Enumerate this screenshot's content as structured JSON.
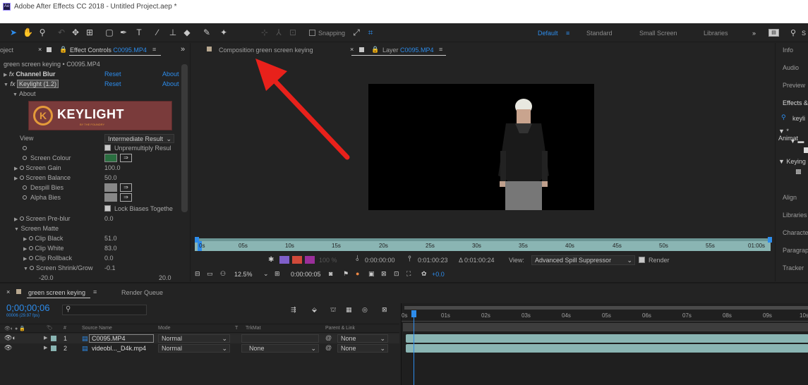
{
  "app": {
    "title": "Adobe After Effects CC 2018 - Untitled Project.aep *",
    "icon_label": "Ae"
  },
  "toolbar": {
    "snapping_label": "Snapping",
    "workspaces": [
      "Default",
      "Standard",
      "Small Screen",
      "Libraries"
    ],
    "active_workspace": "Default",
    "search_partial": "S"
  },
  "effect_controls": {
    "project_tab": "oject",
    "tab_label": "Effect Controls",
    "tab_file": "C0095.MP4",
    "breadcrumb": "green screen keying • C0095.MP4",
    "channel_blur": {
      "name": "Channel Blur",
      "reset": "Reset",
      "about": "About"
    },
    "keylight": {
      "name": "Keylight (1.2)",
      "reset": "Reset",
      "about": "About"
    },
    "about_label": "About",
    "logo_text": "KEYLIGHT",
    "logo_sub": "BY THE FOUNDRY",
    "view_label": "View",
    "view_value": "Intermediate Result",
    "unpremultiply": "Unpremultiply Resul",
    "screen_colour": "Screen Colour",
    "screen_colour_hex": "#2a6e40",
    "screen_gain": "Screen Gain",
    "screen_gain_val": "100.0",
    "screen_balance": "Screen Balance",
    "screen_balance_val": "50.0",
    "despill_bias": "Despill Bies",
    "alpha_bias": "Alpha Bies",
    "lock_biases": "Lock Biases Togethe",
    "screen_preblur": "Screen Pre-blur",
    "screen_preblur_val": "0.0",
    "screen_matte": "Screen Matte",
    "clip_black": "Clip Black",
    "clip_black_val": "51.0",
    "clip_white": "Clip White",
    "clip_white_val": "83.0",
    "clip_rollback": "Clip Rollback",
    "clip_rollback_val": "0.0",
    "shrink_grow": "Screen Shrink/Grow",
    "shrink_grow_val": "-0.1",
    "range_min": "-20.0",
    "range_max": "20.0"
  },
  "composition": {
    "tab_label": "Composition",
    "tab_name": "green screen keying",
    "layer_label": "Layer",
    "layer_name": "C0095.MP4",
    "ruler": [
      "0s",
      "05s",
      "10s",
      "15s",
      "20s",
      "25s",
      "30s",
      "35s",
      "40s",
      "45s",
      "50s",
      "55s",
      "01:00s"
    ],
    "opacity": "100 %",
    "time_in": "0:00:00:00",
    "time_out": "0:01:00:23",
    "duration": "Δ 0:01:00:24",
    "view_label": "View:",
    "view_value": "Advanced Spill Suppressor",
    "render_label": "Render",
    "zoom": "12.5%",
    "current_time": "0:00:00:05",
    "exposure": "+0.0"
  },
  "right_panel": {
    "items": [
      "Info",
      "Audio",
      "Preview",
      "Effects &",
      "Align",
      "Libraries",
      "Character",
      "Paragraph",
      "Tracker"
    ],
    "search_partial": "keyli",
    "tree": [
      "* Animat",
      "Keying"
    ]
  },
  "timeline": {
    "tab_label": "green screen keying",
    "render_queue": "Render Queue",
    "timecode": "0;00;00;06",
    "fps": "00006 (29.97 fps)",
    "headers": {
      "source": "Source Name",
      "mode": "Mode",
      "t": "T",
      "trkmat": "TrkMat",
      "parent": "Parent & Link"
    },
    "layers": [
      {
        "num": "1",
        "name": "C0095.MP4",
        "mode": "Normal",
        "trkmat": "",
        "parent": "None"
      },
      {
        "num": "2",
        "name": "videobl..._D4k.mp4",
        "mode": "Normal",
        "trkmat": "None",
        "parent": "None"
      }
    ],
    "ruler": [
      "0s",
      "01s",
      "02s",
      "03s",
      "04s",
      "05s",
      "06s",
      "07s",
      "08s",
      "09s",
      "10s"
    ]
  },
  "colors": {
    "accent": "#2d8ceb",
    "arrow": "#e8211b",
    "track": "#8ab5b3",
    "playhead": "#2d8ceb"
  }
}
